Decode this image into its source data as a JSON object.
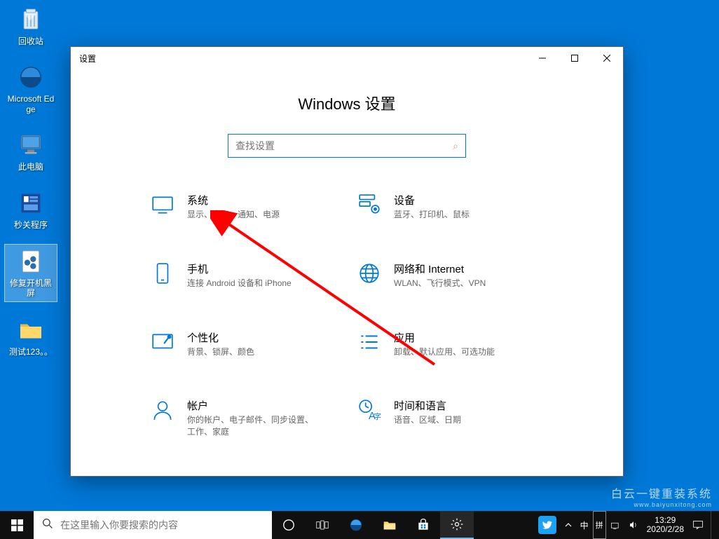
{
  "desktop": {
    "icons": [
      {
        "id": "recycle-bin",
        "label": "回收站"
      },
      {
        "id": "edge",
        "label": "Microsoft Edge"
      },
      {
        "id": "this-pc",
        "label": "此电脑"
      },
      {
        "id": "kill-app",
        "label": "秒关程序"
      },
      {
        "id": "fix-blackscreen",
        "label": "修复开机黑屏"
      },
      {
        "id": "test-folder",
        "label": "测试123。。"
      }
    ]
  },
  "settings_window": {
    "title": "设置",
    "heading": "Windows 设置",
    "search_placeholder": "查找设置",
    "categories": [
      {
        "id": "system",
        "title": "系统",
        "desc": "显示、声音、通知、电源"
      },
      {
        "id": "devices",
        "title": "设备",
        "desc": "蓝牙、打印机、鼠标"
      },
      {
        "id": "phone",
        "title": "手机",
        "desc": "连接 Android 设备和 iPhone"
      },
      {
        "id": "network",
        "title": "网络和 Internet",
        "desc": "WLAN、飞行模式、VPN"
      },
      {
        "id": "personalization",
        "title": "个性化",
        "desc": "背景、锁屏、颜色"
      },
      {
        "id": "apps",
        "title": "应用",
        "desc": "卸载、默认应用、可选功能"
      },
      {
        "id": "accounts",
        "title": "帐户",
        "desc": "你的帐户、电子邮件、同步设置、工作、家庭"
      },
      {
        "id": "time-language",
        "title": "时间和语言",
        "desc": "语音、区域、日期"
      }
    ]
  },
  "taskbar": {
    "search_placeholder": "在这里输入你要搜索的内容",
    "ime": "中",
    "ime2": "拼",
    "time": "13:29",
    "date": "2020/2/28"
  },
  "watermark": {
    "line1": "白云一键重装系统",
    "line2": "www.baiyunxitong.com"
  }
}
